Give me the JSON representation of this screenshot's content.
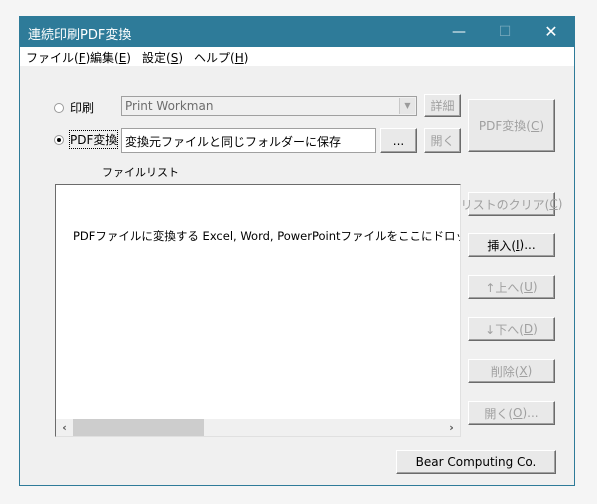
{
  "window": {
    "title": "連続印刷PDF変換",
    "minimize_glyph": "—",
    "maximize_glyph": "☐",
    "close_glyph": "✕"
  },
  "menu": [
    {
      "label": "ファイル(",
      "key": "F",
      "end": ")"
    },
    {
      "label": "編集(",
      "key": "E",
      "end": ")"
    },
    {
      "label": "設定(",
      "key": "S",
      "end": ")"
    },
    {
      "label": "ヘルプ(",
      "key": "H",
      "end": ")"
    }
  ],
  "mode": {
    "print_label": "印刷",
    "print_selected": false,
    "printer_value": "Print Workman",
    "details_button": "詳細",
    "pdf_label": "PDF変換",
    "pdf_selected": true,
    "output_folder_value": "変換元ファイルと同じフォルダーに保存",
    "browse_button": "...",
    "open_button": "開く"
  },
  "convert_button": {
    "label": "PDF変換(",
    "key": "C",
    "end": ")"
  },
  "file_list": {
    "label": "ファイルリスト",
    "empty_message": "PDFファイルに変換する Excel, Word, PowerPointファイルをここにドロップしてください",
    "scroll_left": "‹",
    "scroll_right": "›"
  },
  "side_buttons": [
    {
      "name": "clear-list-button",
      "label": "リストのクリア(",
      "key": "C",
      "end": ")",
      "enabled": false
    },
    {
      "name": "insert-button",
      "label": "挿入(",
      "key": "I",
      "end": ")...",
      "enabled": true
    },
    {
      "name": "move-up-button",
      "label": "↑上へ(",
      "key": "U",
      "end": ")",
      "enabled": false
    },
    {
      "name": "move-down-button",
      "label": "↓下へ(",
      "key": "D",
      "end": ")",
      "enabled": false
    },
    {
      "name": "delete-button",
      "label": "削除(",
      "key": "X",
      "end": ")",
      "enabled": false
    },
    {
      "name": "open-file-button",
      "label": "開く(",
      "key": "O",
      "end": ")...",
      "enabled": false
    }
  ],
  "company_button": "Bear Computing Co."
}
